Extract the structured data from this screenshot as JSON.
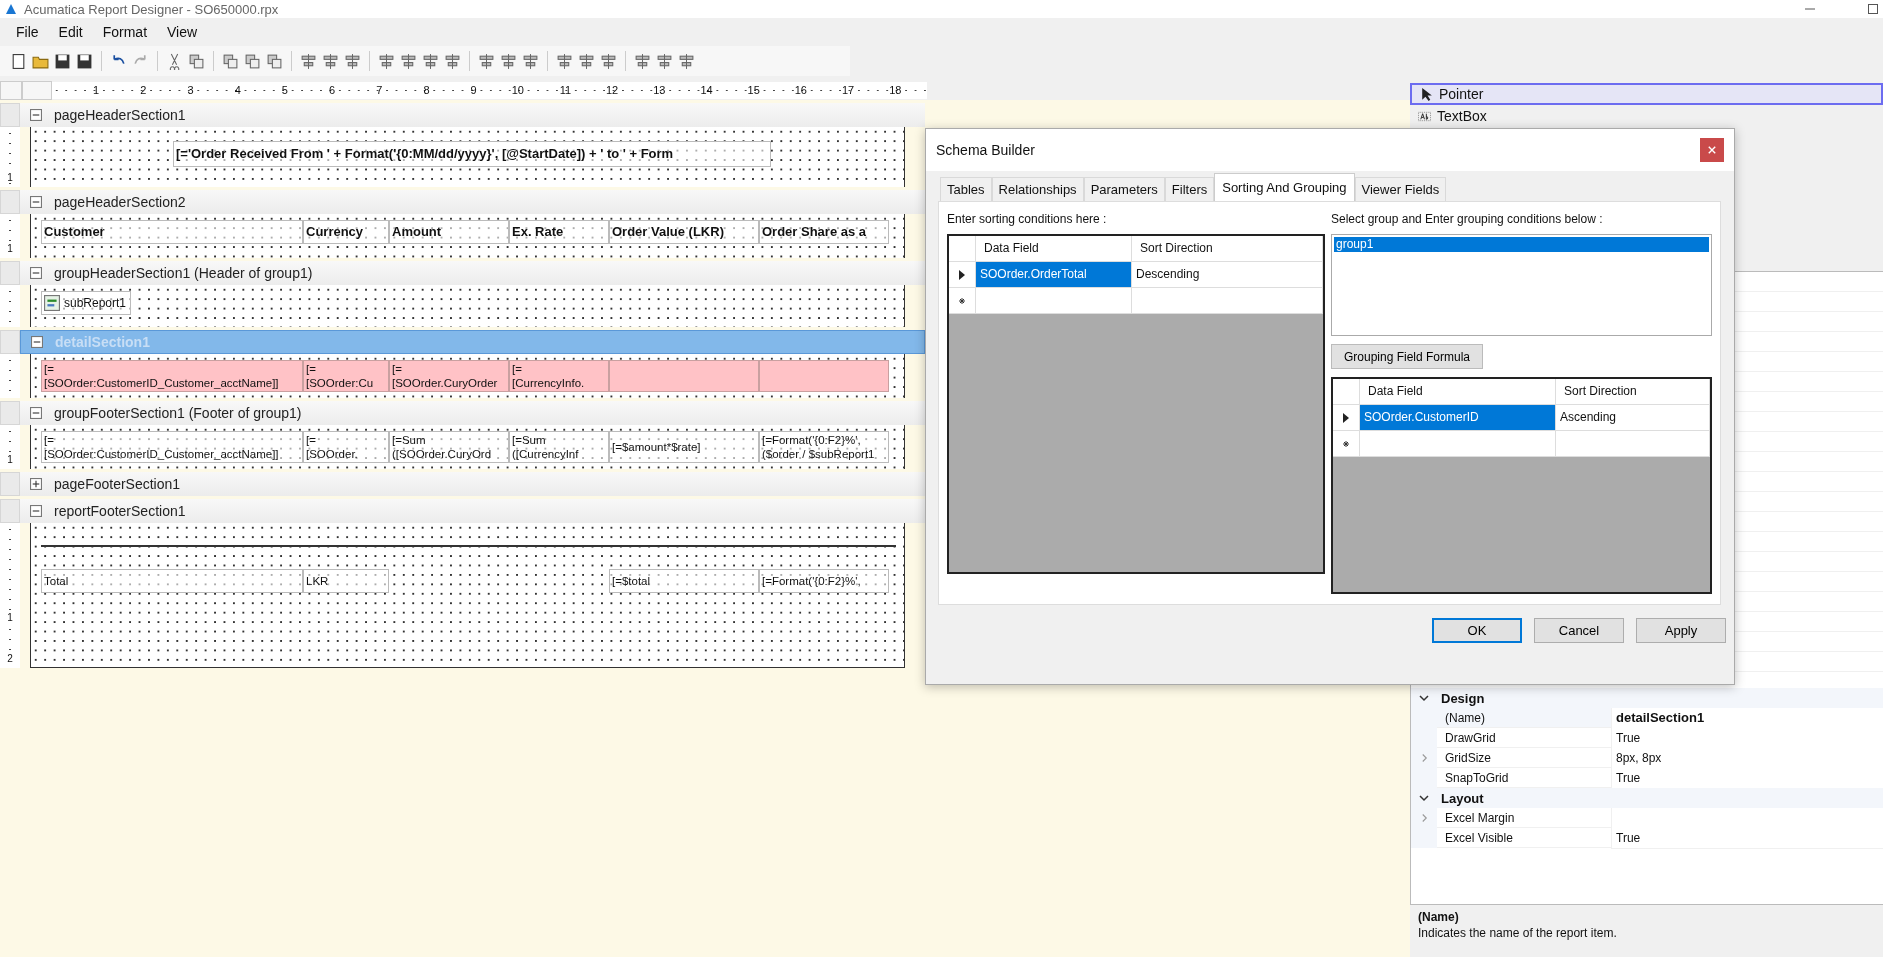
{
  "window": {
    "title": "Acumatica Report Designer - SO650000.rpx"
  },
  "menu": [
    "File",
    "Edit",
    "Format",
    "View"
  ],
  "ruler": [
    "1",
    "2",
    "3",
    "4",
    "5",
    "6",
    "7",
    "8",
    "9",
    "10",
    "11",
    "12",
    "13",
    "14",
    "15",
    "16",
    "17",
    "18"
  ],
  "sections": [
    {
      "title": "pageHeaderSection1",
      "expanded": true,
      "selected": false,
      "highlighted": false,
      "kind": "title",
      "ruler": [
        "1"
      ],
      "cells": [
        {
          "kind": "field",
          "bold": true,
          "text": "[='Order Received From ' + Format('{0:MM/dd/yyyy}', [@StartDate]) + ' to ' + Form"
        }
      ]
    },
    {
      "title": "pageHeaderSection2",
      "expanded": true,
      "selected": false,
      "highlighted": false,
      "kind": "columns",
      "ruler": [
        "1"
      ],
      "cells": [
        {
          "kind": "field",
          "bold": true,
          "text": "Customer"
        },
        {
          "kind": "field",
          "bold": true,
          "text": "Currency"
        },
        {
          "kind": "field",
          "bold": true,
          "text": "Amount"
        },
        {
          "kind": "field",
          "bold": true,
          "text": "Ex. Rate"
        },
        {
          "kind": "field",
          "bold": true,
          "text": "Order Value (LKR)"
        },
        {
          "kind": "field",
          "bold": true,
          "text": "Order Share as a"
        }
      ]
    },
    {
      "title": "groupHeaderSection1 (Header of group1)",
      "expanded": true,
      "selected": false,
      "highlighted": false,
      "kind": "subreport",
      "cells": [
        {
          "kind": "subreport",
          "bold": false,
          "text": "subReport1"
        }
      ]
    },
    {
      "title": "detailSection1",
      "expanded": true,
      "selected": true,
      "highlighted": true,
      "kind": "columns",
      "cells": [
        {
          "kind": "field",
          "bold": false,
          "text": "[=\n[SOOrder:CustomerID_Customer_acctName]]"
        },
        {
          "kind": "field",
          "bold": false,
          "text": "[=\n[SOOrder:Cu"
        },
        {
          "kind": "field",
          "bold": false,
          "text": "[=\n[SOOrder.CuryOrder"
        },
        {
          "kind": "field",
          "bold": false,
          "text": "[=\n[CurrencyInfo."
        },
        {
          "kind": "empty"
        },
        {
          "kind": "empty"
        }
      ]
    },
    {
      "title": "groupFooterSection1 (Footer of group1)",
      "expanded": true,
      "selected": false,
      "highlighted": false,
      "kind": "columns",
      "ruler": [
        "1"
      ],
      "cells": [
        {
          "kind": "field",
          "bold": false,
          "text": "[=\n[SOOrder:CustomerID_Customer_acctName]]"
        },
        {
          "kind": "field",
          "bold": false,
          "text": "[=\n[SOOrder."
        },
        {
          "kind": "field",
          "bold": false,
          "text": "[=Sum\n([SOOrder.CuryOrd"
        },
        {
          "kind": "field",
          "bold": false,
          "text": "[=Sum\n([CurrencyInf"
        },
        {
          "kind": "field",
          "bold": false,
          "text": "[=$amount*$rate]"
        },
        {
          "kind": "field",
          "bold": false,
          "text": "[=Format('{0:F2}%',\n($order / $subReport1"
        }
      ]
    },
    {
      "title": "pageFooterSection1",
      "expanded": false,
      "selected": false
    },
    {
      "title": "reportFooterSection1",
      "expanded": true,
      "selected": false,
      "highlighted": false,
      "kind": "totals",
      "ruler": [
        "1",
        "2"
      ],
      "cells": [
        {
          "kind": "field",
          "bold": false,
          "text": "Total"
        },
        {
          "kind": "field",
          "bold": false,
          "text": "LKR"
        },
        {
          "kind": "gap"
        },
        {
          "kind": "gap"
        },
        {
          "kind": "field",
          "bold": false,
          "text": "[=$total"
        },
        {
          "kind": "field",
          "bold": false,
          "text": "[=Format('{0:F2}%',"
        }
      ]
    }
  ],
  "toolbox": [
    {
      "label": "Pointer",
      "selected": true
    },
    {
      "label": "TextBox",
      "selected": false
    }
  ],
  "properties": {
    "categories": [
      {
        "name": "Design",
        "expanded": true,
        "rows": [
          {
            "name": "(Name)",
            "value": "detailSection1",
            "selected": true,
            "non_default": true,
            "expandable": false
          },
          {
            "name": "DrawGrid",
            "value": "True",
            "selected": false,
            "non_default": false,
            "expandable": false
          },
          {
            "name": "GridSize",
            "value": "8px, 8px",
            "selected": false,
            "non_default": false,
            "expandable": true
          },
          {
            "name": "SnapToGrid",
            "value": "True",
            "selected": false,
            "non_default": false,
            "expandable": false
          }
        ]
      },
      {
        "name": "Layout",
        "expanded": true,
        "rows": [
          {
            "name": "Excel Margin",
            "selected": false,
            "expandable": true
          },
          {
            "name": "Excel Visible",
            "value": "True",
            "selected": false,
            "non_default": false,
            "expandable": false
          }
        ]
      }
    ]
  },
  "description": {
    "title": "(Name)",
    "text": "Indicates the name of the report item."
  },
  "dialog": {
    "title": "Schema Builder",
    "tabs": [
      {
        "label": "Tables",
        "selected": false
      },
      {
        "label": "Relationships",
        "selected": false
      },
      {
        "label": "Parameters",
        "selected": false
      },
      {
        "label": "Filters",
        "selected": false
      },
      {
        "label": "Sorting And Grouping",
        "selected": true
      },
      {
        "label": "Viewer Fields",
        "selected": false
      }
    ],
    "sort": {
      "label": "Enter sorting conditions here :",
      "columns": [
        "Data Field",
        "Sort Direction"
      ],
      "rows": [
        {
          "field": "SOOrder.OrderTotal",
          "direction": "Descending",
          "selected": true
        }
      ]
    },
    "group": {
      "label": "Select group and Enter grouping conditions below :",
      "groups": [
        {
          "label": "group1",
          "selected": true
        }
      ],
      "formula_button": "Grouping Field Formula",
      "columns": [
        "Data Field",
        "Sort Direction"
      ],
      "rows": [
        {
          "field": "SOOrder.CustomerID",
          "direction": "Ascending",
          "selected": true
        }
      ]
    },
    "buttons": [
      {
        "label": "OK",
        "default": true
      },
      {
        "label": "Cancel",
        "default": false
      },
      {
        "label": "Apply",
        "default": false
      }
    ]
  }
}
